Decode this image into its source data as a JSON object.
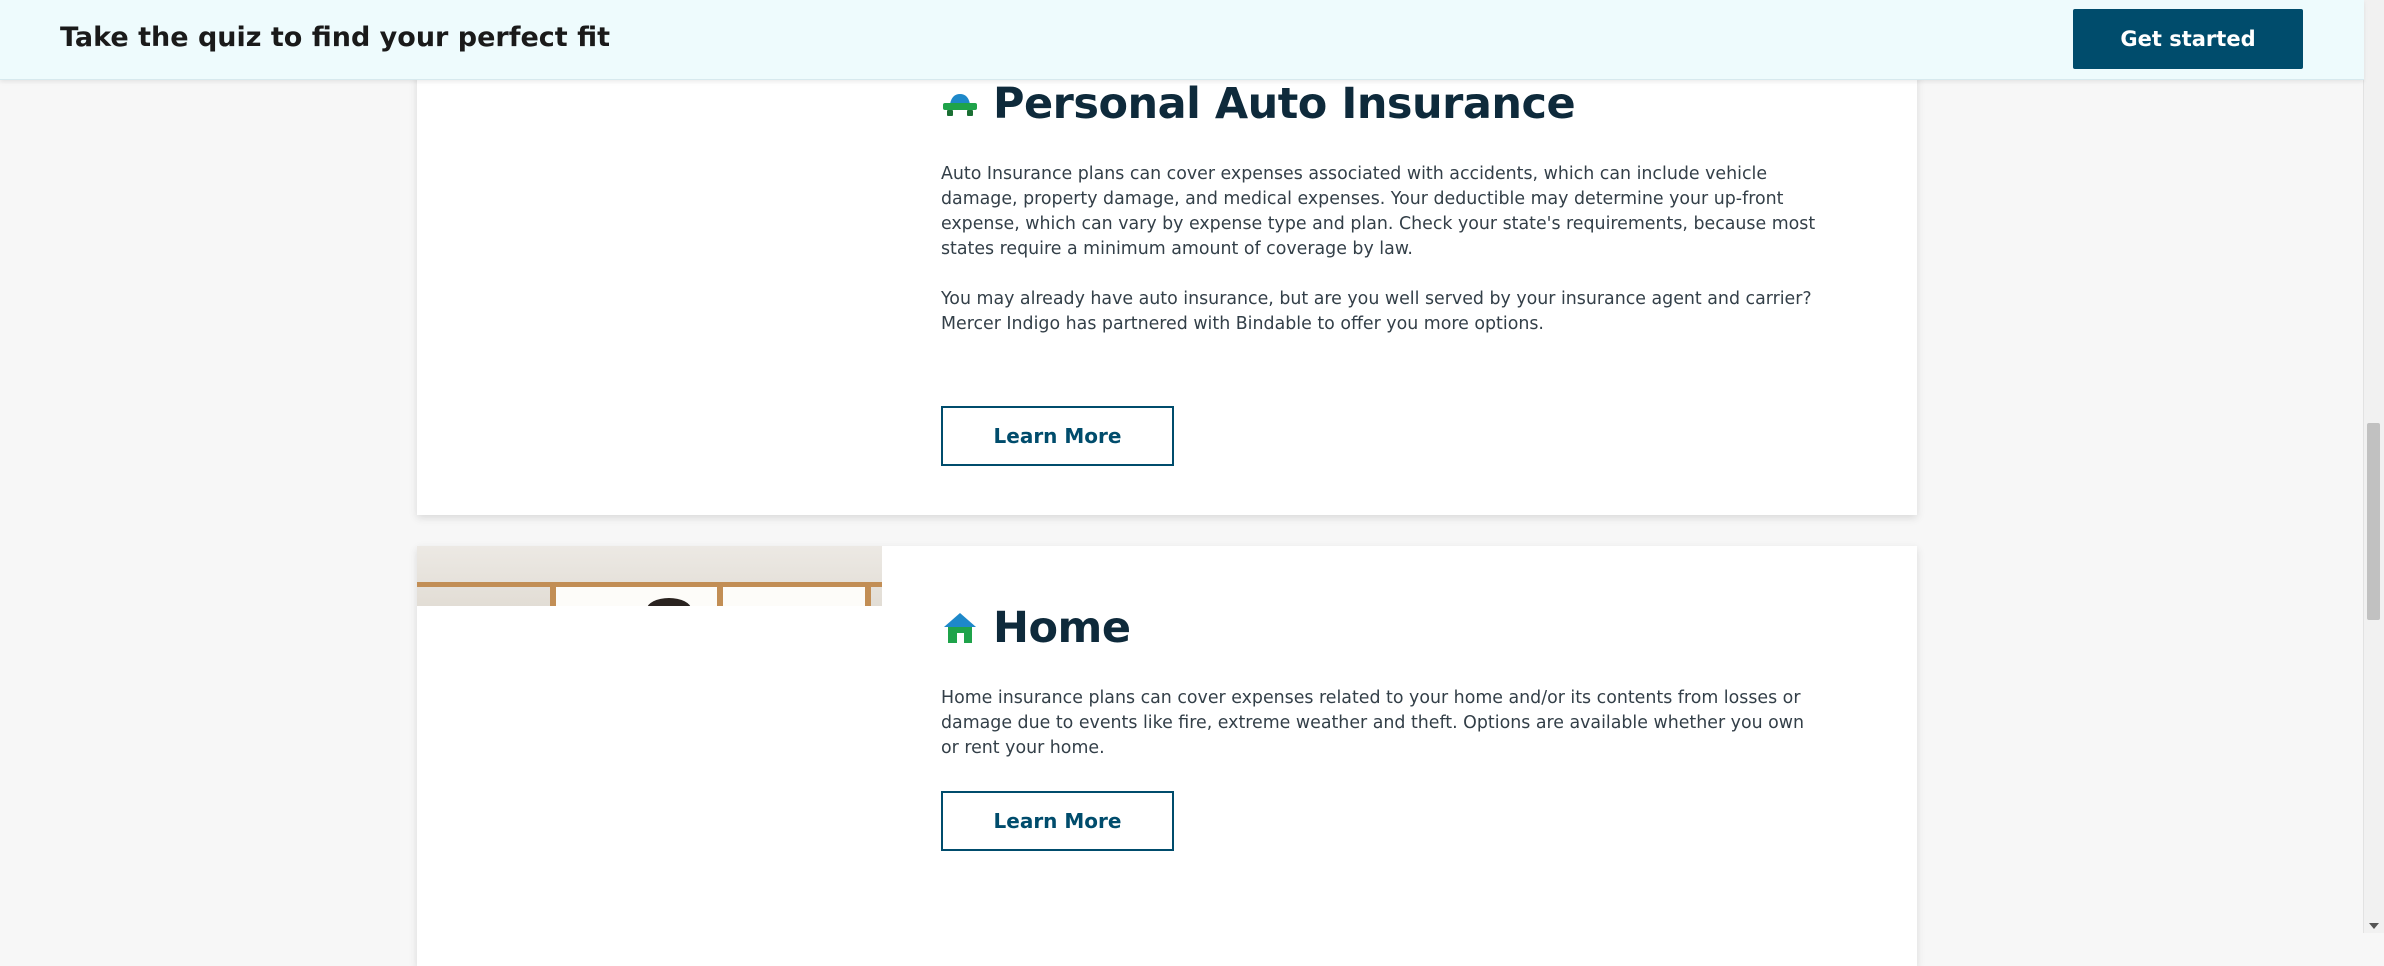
{
  "quiz_banner": {
    "text": "Take the quiz to find your perfect fit",
    "button_label": "Get started"
  },
  "cards": [
    {
      "id": "auto",
      "title": "Personal Auto Insurance",
      "icon": "car-icon",
      "paragraphs": [
        "Auto Insurance plans can cover expenses associated with accidents, which can include vehicle damage, property damage, and medical expenses. Your deductible may determine your up-front expense, which can vary by expense type and plan. Check your state's requirements, because most states require a minimum amount of coverage by law.",
        "You may already have auto insurance, but are you well served by your insurance agent and carrier? Mercer Indigo has partnered with Bindable to offer you more options."
      ],
      "button_label": "Learn More"
    },
    {
      "id": "home",
      "title": "Home",
      "icon": "house-icon",
      "paragraphs": [
        "Home insurance plans can cover expenses related to your home and/or its contents from losses or damage due to events like fire, extreme weather and theft. Options are available whether you own or rent your home."
      ],
      "button_label": "Learn More"
    }
  ],
  "colors": {
    "brand_primary": "#004c6c",
    "banner_bg": "#eefbfd",
    "icon_green": "#1fa34a",
    "icon_blue": "#1e88c9"
  }
}
